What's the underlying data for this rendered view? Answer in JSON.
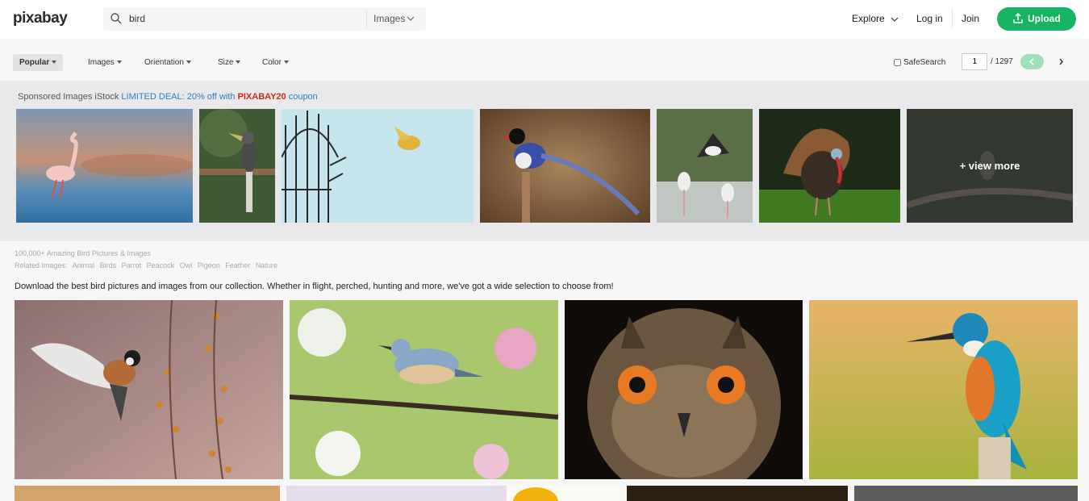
{
  "header": {
    "logo": "pixabay",
    "search": {
      "value": "bird",
      "type_label": "Images"
    },
    "nav": {
      "explore": "Explore",
      "login": "Log in",
      "join": "Join",
      "upload": "Upload"
    },
    "colors": {
      "brand_green": "#16b361",
      "link_blue": "#2d7fc1",
      "coupon_red": "#d9261c"
    }
  },
  "filters": {
    "items": [
      "Popular",
      "Images",
      "Orientation",
      "Size",
      "Color"
    ],
    "safesearch": "SafeSearch",
    "page": {
      "current": "1",
      "total": "/ 1297"
    }
  },
  "sponsored": {
    "prefix": "Sponsored Images iStock",
    "deal": "LIMITED DEAL: 20% off with",
    "code": "PIXABAY20",
    "suffix": "coupon",
    "view_more": "+ view more",
    "images": [
      "flamingo",
      "hornbill",
      "bird-cage",
      "blue-magpie",
      "storks",
      "turkey",
      "bulbul"
    ]
  },
  "related": {
    "title": "100,000+ Amazing Bird Pictures & Images",
    "label": "Related Images:",
    "links": [
      "Animal",
      "Birds",
      "Parrot",
      "Peacock",
      "Owl",
      "Pigeon",
      "Feather",
      "Nature"
    ],
    "description": "Download the best bird pictures and images from our collection. Whether in flight, perched, hunting and more, we've got a wide selection to choose from!"
  },
  "gallery": {
    "images": [
      "tit-in-flight",
      "nuthatch-blossoms",
      "eagle-owl",
      "kingfisher"
    ]
  }
}
